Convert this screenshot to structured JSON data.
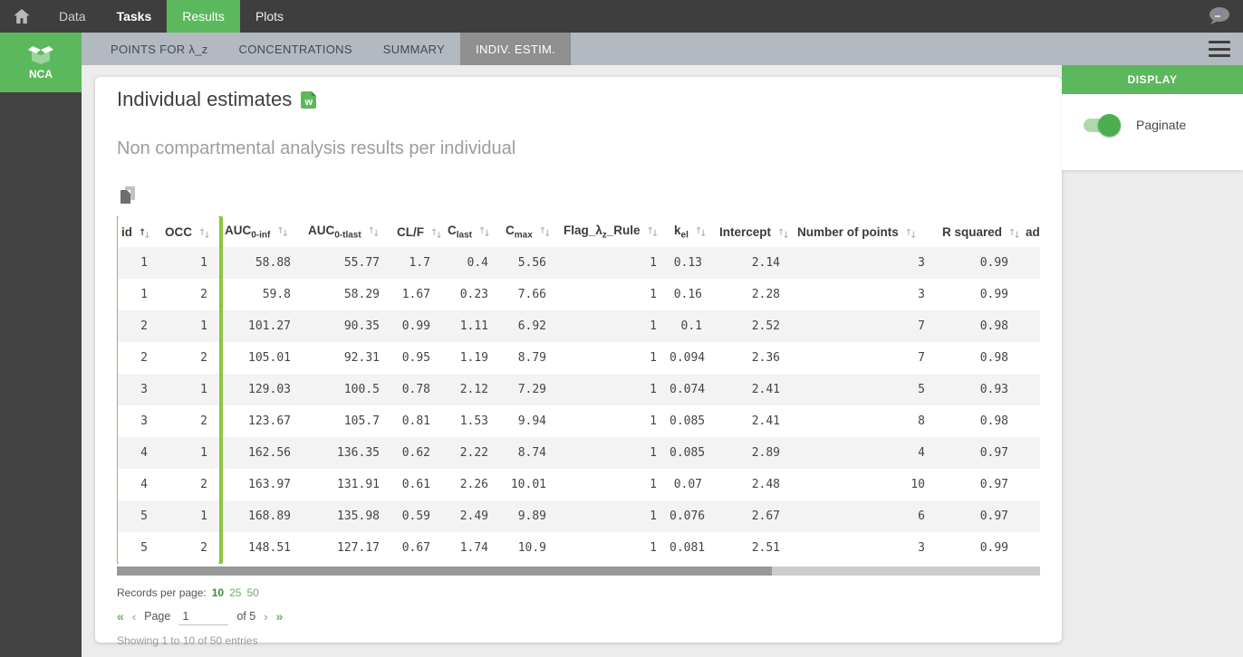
{
  "nav": {
    "items": [
      {
        "label": "Data"
      },
      {
        "label": "Tasks"
      },
      {
        "label": "Results"
      },
      {
        "label": "Plots"
      }
    ]
  },
  "tabs": {
    "items": [
      {
        "label": "POINTS FOR λ_z",
        "active": false
      },
      {
        "label": "CONCENTRATIONS",
        "active": false
      },
      {
        "label": "SUMMARY",
        "active": false
      },
      {
        "label": "INDIV. ESTIM.",
        "active": true
      }
    ]
  },
  "sidebar": {
    "app_label": "NCA"
  },
  "main": {
    "title": "Individual estimates",
    "subtitle": "Non compartmental analysis results per individual",
    "table": {
      "columns": [
        {
          "base": "id",
          "sub": "",
          "suffix": "",
          "sorted": "asc"
        },
        {
          "base": "OCC",
          "sub": "",
          "suffix": ""
        },
        {
          "base": "AUC",
          "sub": "0-inf",
          "suffix": ""
        },
        {
          "base": "AUC",
          "sub": "0-tlast",
          "suffix": ""
        },
        {
          "base": "CL/F",
          "sub": "",
          "suffix": ""
        },
        {
          "base": "C",
          "sub": "last",
          "suffix": ""
        },
        {
          "base": "C",
          "sub": "max",
          "suffix": ""
        },
        {
          "base": "Flag_λ",
          "sub": "z",
          "suffix": "_Rule"
        },
        {
          "base": "k",
          "sub": "el",
          "suffix": ""
        },
        {
          "base": "Intercept",
          "sub": "",
          "suffix": ""
        },
        {
          "base": "Number of points",
          "sub": "",
          "suffix": ""
        },
        {
          "base": "R squared",
          "sub": "",
          "suffix": ""
        },
        {
          "base": "ad",
          "sub": "",
          "suffix": "",
          "sortable": false
        }
      ],
      "rows": [
        [
          "1",
          "1",
          "58.88",
          "55.77",
          "1.7",
          "0.4",
          "5.56",
          "1",
          "0.13",
          "2.14",
          "3",
          "0.99",
          ""
        ],
        [
          "1",
          "2",
          "59.8",
          "58.29",
          "1.67",
          "0.23",
          "7.66",
          "1",
          "0.16",
          "2.28",
          "3",
          "0.99",
          ""
        ],
        [
          "2",
          "1",
          "101.27",
          "90.35",
          "0.99",
          "1.11",
          "6.92",
          "1",
          "0.1",
          "2.52",
          "7",
          "0.98",
          ""
        ],
        [
          "2",
          "2",
          "105.01",
          "92.31",
          "0.95",
          "1.19",
          "8.79",
          "1",
          "0.094",
          "2.36",
          "7",
          "0.98",
          ""
        ],
        [
          "3",
          "1",
          "129.03",
          "100.5",
          "0.78",
          "2.12",
          "7.29",
          "1",
          "0.074",
          "2.41",
          "5",
          "0.93",
          ""
        ],
        [
          "3",
          "2",
          "123.67",
          "105.7",
          "0.81",
          "1.53",
          "9.94",
          "1",
          "0.085",
          "2.41",
          "8",
          "0.98",
          ""
        ],
        [
          "4",
          "1",
          "162.56",
          "136.35",
          "0.62",
          "2.22",
          "8.74",
          "1",
          "0.085",
          "2.89",
          "4",
          "0.97",
          ""
        ],
        [
          "4",
          "2",
          "163.97",
          "131.91",
          "0.61",
          "2.26",
          "10.01",
          "1",
          "0.07",
          "2.48",
          "10",
          "0.97",
          ""
        ],
        [
          "5",
          "1",
          "168.89",
          "135.98",
          "0.59",
          "2.49",
          "9.89",
          "1",
          "0.076",
          "2.67",
          "6",
          "0.97",
          ""
        ],
        [
          "5",
          "2",
          "148.51",
          "127.17",
          "0.67",
          "1.74",
          "10.9",
          "1",
          "0.081",
          "2.51",
          "3",
          "0.99",
          ""
        ]
      ]
    },
    "pagination": {
      "records_label": "Records per page:",
      "options": [
        "10",
        "25",
        "50"
      ],
      "selected_option": "10",
      "first_icon": "«",
      "prev_icon": "‹",
      "page_label": "Page",
      "page_value": "1",
      "of_label": "of 5",
      "next_icon": "›",
      "last_icon": "»",
      "summary": "Showing 1 to 10 of 50 entries"
    }
  },
  "display_panel": {
    "header": "DISPLAY",
    "toggle_label": "Paginate",
    "toggle_on": true
  },
  "colors": {
    "accent_green": "#5cb85c",
    "highlight_green": "#8cc63e",
    "active_tab_gray": "#8f8f8f",
    "topnav_gray": "#3e3e3e"
  }
}
